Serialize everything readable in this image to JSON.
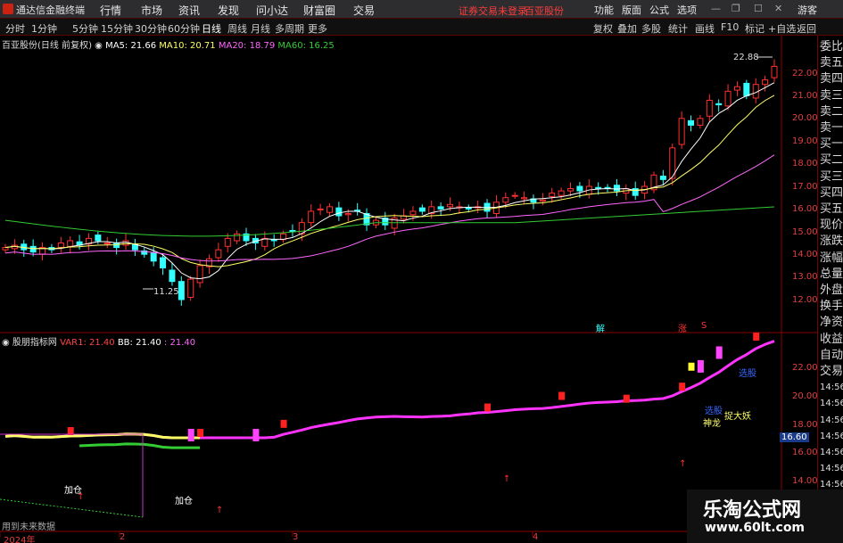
{
  "titlebar": {
    "app": "通达信金融终端",
    "menus": [
      "行情",
      "市场",
      "资讯",
      "发现",
      "问小达",
      "财富圈",
      "交易"
    ],
    "status": "证券交易未登录",
    "stock": "百亚股份",
    "right_menus": [
      "功能",
      "版面",
      "公式",
      "选项",
      "游客"
    ]
  },
  "toolbar": {
    "periods": [
      "分时",
      "1分钟",
      "5分钟",
      "15分钟",
      "30分钟",
      "60分钟",
      "日线",
      "周线",
      "月线",
      "多周期",
      "更多"
    ],
    "active": "日线",
    "right": [
      "复权",
      "叠加",
      "多股",
      "统计",
      "画线",
      "F10",
      "标记",
      "+自选",
      "返回"
    ]
  },
  "main_chart": {
    "title": "百亚股份(日线 前复权)",
    "ma": [
      {
        "label": "MA5: 21.66",
        "color": "#ffffff"
      },
      {
        "label": "MA10: 20.71",
        "color": "#ffff66"
      },
      {
        "label": "MA20: 18.79",
        "color": "#ff66ff"
      },
      {
        "label": "MA60: 16.25",
        "color": "#33cc33"
      }
    ],
    "high_label": "22.88",
    "low_label": "11.25",
    "price_ticks": [
      "22.00",
      "21.00",
      "20.00",
      "19.00",
      "18.00",
      "17.00",
      "16.00",
      "15.00",
      "14.00",
      "13.00",
      "12.00"
    ],
    "markers": [
      {
        "text": "解",
        "color": "#33ffff"
      },
      {
        "text": "涨",
        "color": "#ff3333"
      },
      {
        "text": "S",
        "color": "#ff3333"
      }
    ]
  },
  "indicator": {
    "name": "股朋指标网",
    "var1": "VAR1: 21.40",
    "bb": "BB: 21.40",
    "val": "21.40",
    "ticks": [
      "22.00",
      "20.00",
      "18.00",
      "16.00",
      "14.00"
    ],
    "current": "16.60",
    "labels": [
      "加仓",
      "加仓",
      "神龙",
      "捉大妖",
      "选股",
      "选股"
    ],
    "note": "用到未来数据"
  },
  "xaxis": [
    "2024年",
    "2",
    "3",
    "4"
  ],
  "rightpanel": [
    "委比",
    "卖五",
    "卖四",
    "卖三",
    "卖二",
    "卖一",
    "买一",
    "买二",
    "买三",
    "买四",
    "买五",
    "现价",
    "涨跌",
    "涨幅",
    "总量",
    "外盘",
    "换手",
    "净资",
    "收益",
    "自动",
    "交易",
    "14:56",
    "14:56",
    "14:56",
    "14:56",
    "14:56",
    "14:56",
    "14:56",
    "14:56",
    "14:56"
  ],
  "watermark": {
    "line1": "乐淘公式网",
    "line2": "www.60lt.com"
  },
  "chart_data": {
    "type": "candlestick",
    "closes": [
      14.3,
      14.4,
      14.2,
      14.1,
      14.3,
      14.2,
      14.5,
      14.6,
      14.4,
      14.7,
      14.6,
      14.5,
      14.3,
      14.6,
      14.2,
      14.0,
      13.7,
      13.4,
      12.8,
      12.0,
      12.9,
      13.5,
      13.8,
      14.2,
      14.7,
      14.9,
      14.6,
      14.5,
      14.7,
      14.6,
      14.9,
      15.0,
      15.4,
      15.9,
      16.0,
      16.1,
      15.7,
      15.8,
      15.9,
      15.3,
      15.5,
      15.3,
      15.6,
      15.7,
      15.9,
      15.9,
      16.1,
      16.0,
      16.2,
      16.1,
      16.0,
      16.1,
      15.9,
      16.3,
      16.5,
      16.6,
      16.5,
      16.3,
      16.4,
      16.7,
      16.8,
      16.9,
      16.8,
      17.0,
      16.9,
      16.9,
      16.8,
      16.9,
      16.6,
      17.0,
      17.5,
      17.3,
      18.7,
      20.0,
      19.7,
      20.0,
      20.8,
      20.6,
      21.2,
      21.4,
      21.0,
      21.5,
      21.7,
      22.3
    ]
  }
}
